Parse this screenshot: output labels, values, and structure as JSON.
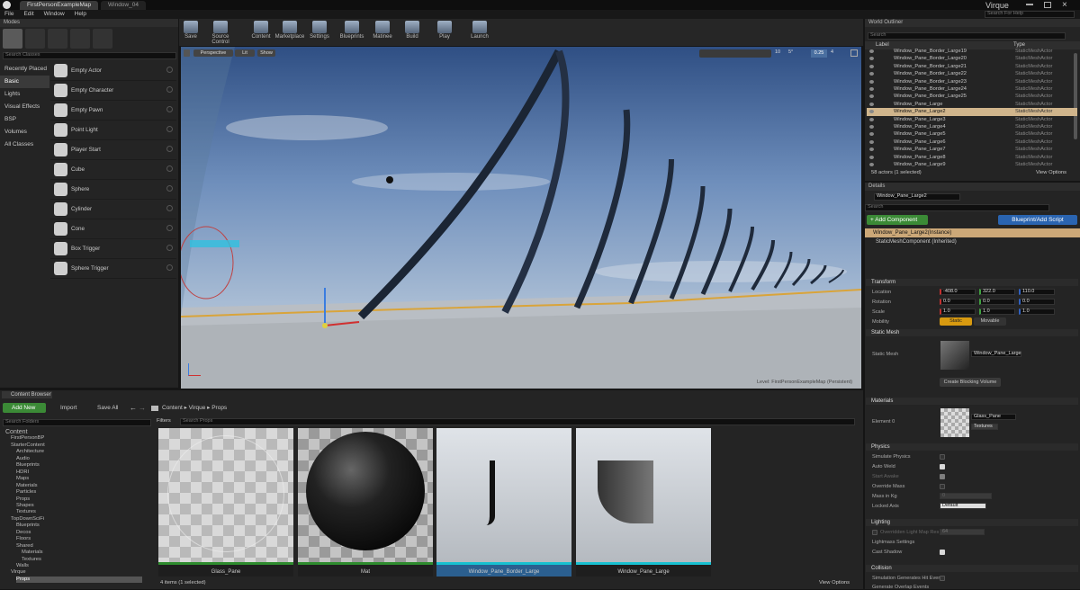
{
  "window": {
    "tabs": [
      "FirstPersonExampleMap",
      "Window_04"
    ],
    "app_name": "Virque",
    "search_help_placeholder": "Search For Help"
  },
  "menu": [
    "File",
    "Edit",
    "Window",
    "Help"
  ],
  "modes": {
    "title": "Modes",
    "search_placeholder": "Search Classes",
    "categories": [
      "Recently Placed",
      "Basic",
      "Lights",
      "Visual Effects",
      "BSP",
      "Volumes",
      "All Classes"
    ],
    "items": [
      "Empty Actor",
      "Empty Character",
      "Empty Pawn",
      "Point Light",
      "Player Start",
      "Cube",
      "Sphere",
      "Cylinder",
      "Cone",
      "Box Trigger",
      "Sphere Trigger"
    ]
  },
  "toolbar": [
    "Save",
    "Source Control",
    "Content",
    "Marketplace",
    "Settings",
    "Blueprints",
    "Matinee",
    "Build",
    "Play",
    "Launch"
  ],
  "viewport": {
    "perspective": "Perspective",
    "lit": "Lit",
    "show": "Show",
    "level_label": "Level:  FirstPersonExampleMap (Persistent)",
    "fov": "90",
    "snap": "10",
    "rot": "5°",
    "scale": "0.25",
    "cam": "4"
  },
  "outliner": {
    "title": "World Outliner",
    "search_placeholder": "Search",
    "col_label": "Label",
    "col_type": "Type",
    "rows": [
      {
        "label": "Window_Pane_Border_Large19",
        "type": "StaticMeshActor"
      },
      {
        "label": "Window_Pane_Border_Large20",
        "type": "StaticMeshActor"
      },
      {
        "label": "Window_Pane_Border_Large21",
        "type": "StaticMeshActor"
      },
      {
        "label": "Window_Pane_Border_Large22",
        "type": "StaticMeshActor"
      },
      {
        "label": "Window_Pane_Border_Large23",
        "type": "StaticMeshActor"
      },
      {
        "label": "Window_Pane_Border_Large24",
        "type": "StaticMeshActor"
      },
      {
        "label": "Window_Pane_Border_Large25",
        "type": "StaticMeshActor"
      },
      {
        "label": "Window_Pane_Large",
        "type": "StaticMeshActor"
      },
      {
        "label": "Window_Pane_Large2",
        "type": "StaticMeshActor"
      },
      {
        "label": "Window_Pane_Large3",
        "type": "StaticMeshActor"
      },
      {
        "label": "Window_Pane_Large4",
        "type": "StaticMeshActor"
      },
      {
        "label": "Window_Pane_Large5",
        "type": "StaticMeshActor"
      },
      {
        "label": "Window_Pane_Large6",
        "type": "StaticMeshActor"
      },
      {
        "label": "Window_Pane_Large7",
        "type": "StaticMeshActor"
      },
      {
        "label": "Window_Pane_Large8",
        "type": "StaticMeshActor"
      },
      {
        "label": "Window_Pane_Large9",
        "type": "StaticMeshActor"
      }
    ],
    "selected_index": 8,
    "status": "58 actors (1 selected)",
    "view_options": "View Options"
  },
  "details": {
    "title": "Details",
    "name_value": "Window_Pane_Large2",
    "search_placeholder": "Search",
    "add_component": "+ Add Component",
    "blueprint_button": "Blueprint/Add Script",
    "instance": "Window_Pane_Large2(Instance)",
    "component": "StaticMeshComponent (Inherited)",
    "transform": {
      "title": "Transform",
      "location_label": "Location",
      "location": [
        "-408.0",
        "322.0",
        "110.0"
      ],
      "rotation_label": "Rotation",
      "rotation": [
        "0.0",
        "0.0",
        "0.0"
      ],
      "scale_label": "Scale",
      "scale": [
        "1.0",
        "1.0",
        "1.0"
      ],
      "mobility_label": "Mobility",
      "static": "Static",
      "movable": "Movable"
    },
    "static_mesh": {
      "title": "Static Mesh",
      "label": "Static Mesh",
      "value": "Window_Pane_Large",
      "blocking_button": "Create Blocking Volume"
    },
    "materials": {
      "title": "Materials",
      "element_label": "Element 0",
      "value": "Glass_Pane",
      "textures": "Textures"
    },
    "physics": {
      "title": "Physics",
      "simulate": "Simulate Physics",
      "auto_weld": "Auto Weld",
      "start_awake": "Start Awake",
      "override_mass": "Override Mass",
      "mass": "Mass in Kg",
      "mass_value": "0",
      "locked_axis": "Locked Axis",
      "locked_value": "Default"
    },
    "lighting": {
      "title": "Lighting",
      "override_lmr": "Overridden Light Map Res",
      "override_value": "64",
      "lightmass": "Lightmass Settings",
      "cast_shadow": "Cast Shadow"
    },
    "collision": {
      "title": "Collision",
      "sim_hit": "Simulation Generates Hit Events",
      "gen_overlap": "Generate Overlap Events"
    }
  },
  "content": {
    "tab": "Content Browser",
    "add_new": "Add New",
    "import": "Import",
    "save_all": "Save All",
    "path": [
      "Content",
      "Virque",
      "Props"
    ],
    "search_folders": "Search Folders",
    "filters": "Filters",
    "search_props": "Search Props",
    "tree": [
      "Content",
      "FirstPersonBP",
      "StarterContent",
      "Architecture",
      "Audio",
      "Blueprints",
      "HDRI",
      "Maps",
      "Materials",
      "Particles",
      "Props",
      "Shapes",
      "Textures",
      "TopDownSciFi",
      "Blueprints",
      "Decos",
      "Floors",
      "Shared",
      "Materials",
      "Textures",
      "Walls",
      "Virque",
      "Props"
    ],
    "assets": [
      {
        "name": "Glass_Pane",
        "bar": "#2e8b2e"
      },
      {
        "name": "Mat",
        "bar": "#2e8b2e"
      },
      {
        "name": "Window_Pane_Border_Large",
        "bar": "#18c0d0"
      },
      {
        "name": "Window_Pane_Large",
        "bar": "#18c0d0"
      }
    ],
    "status": "4 items (1 selected)",
    "view_options": "View Options"
  }
}
